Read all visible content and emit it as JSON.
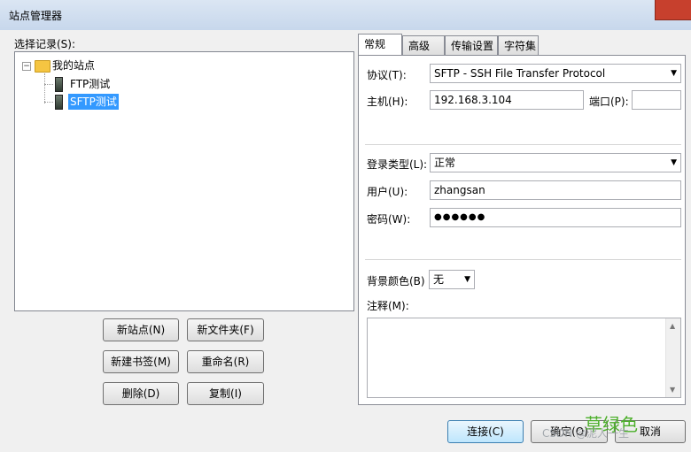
{
  "window": {
    "title": "站点管理器"
  },
  "tree": {
    "label": "选择记录(S):",
    "root": "我的站点",
    "children": [
      "FTP测试",
      "SFTP测试"
    ],
    "selected_index": 1
  },
  "buttons": {
    "new_site": "新站点(N)",
    "new_folder": "新文件夹(F)",
    "new_bookmark": "新建书签(M)",
    "rename": "重命名(R)",
    "delete": "删除(D)",
    "copy": "复制(I)",
    "connect": "连接(C)",
    "ok": "确定(O)",
    "cancel": "取消"
  },
  "tabs": [
    "常规",
    "高级",
    "传输设置",
    "字符集"
  ],
  "general": {
    "protocol_label": "协议(T):",
    "protocol_value": "SFTP - SSH File Transfer Protocol",
    "host_label": "主机(H):",
    "host_value": "192.168.3.104",
    "port_label": "端口(P):",
    "port_value": "",
    "logon_type_label": "登录类型(L):",
    "logon_type_value": "正常",
    "user_label": "用户(U):",
    "user_value": "zhangsan",
    "password_label": "密码(W):",
    "password_value": "●●●●●●",
    "bgcolor_label": "背景颜色(B)",
    "bgcolor_value": "无",
    "comments_label": "注释(M):"
  },
  "watermark": {
    "big": "草绿色",
    "small": "CSDN @泥人一生"
  }
}
